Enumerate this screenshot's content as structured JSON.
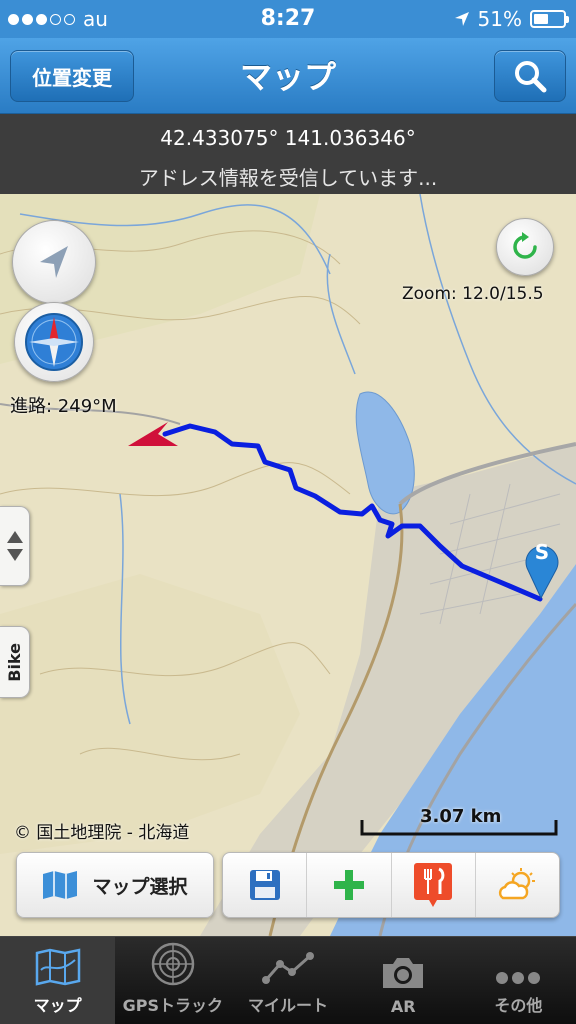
{
  "status_bar": {
    "carrier": "au",
    "time": "8:27",
    "battery": "51%",
    "battery_level": 0.51
  },
  "nav": {
    "title": "マップ",
    "left_button": "位置変更",
    "right_button_icon": "search-icon"
  },
  "info": {
    "coordinates": "42.433075° 141.036346°",
    "address_status": "アドレス情報を受信しています..."
  },
  "map": {
    "zoom": "Zoom: 12.0/15.5",
    "heading": "進路: 249°M",
    "copyright": "© 国土地理院 - 北海道",
    "scale": "3.07 km",
    "start_marker": "S",
    "side_tab_label": "Bike",
    "map_select_label": "マップ選択",
    "tools": [
      "save-icon",
      "add-icon",
      "restaurant-icon",
      "weather-icon"
    ],
    "colors": {
      "track": "#0a1fe0",
      "water": "#8fb8e8",
      "marker": "#2a86d6",
      "arrow": "#d0103a"
    }
  },
  "tabs": [
    {
      "label": "マップ",
      "icon": "map-icon",
      "active": true
    },
    {
      "label": "GPSトラック",
      "icon": "radar-icon",
      "active": false
    },
    {
      "label": "マイルート",
      "icon": "route-icon",
      "active": false
    },
    {
      "label": "AR",
      "icon": "camera-icon",
      "active": false
    },
    {
      "label": "その他",
      "icon": "more-icon",
      "active": false
    }
  ]
}
